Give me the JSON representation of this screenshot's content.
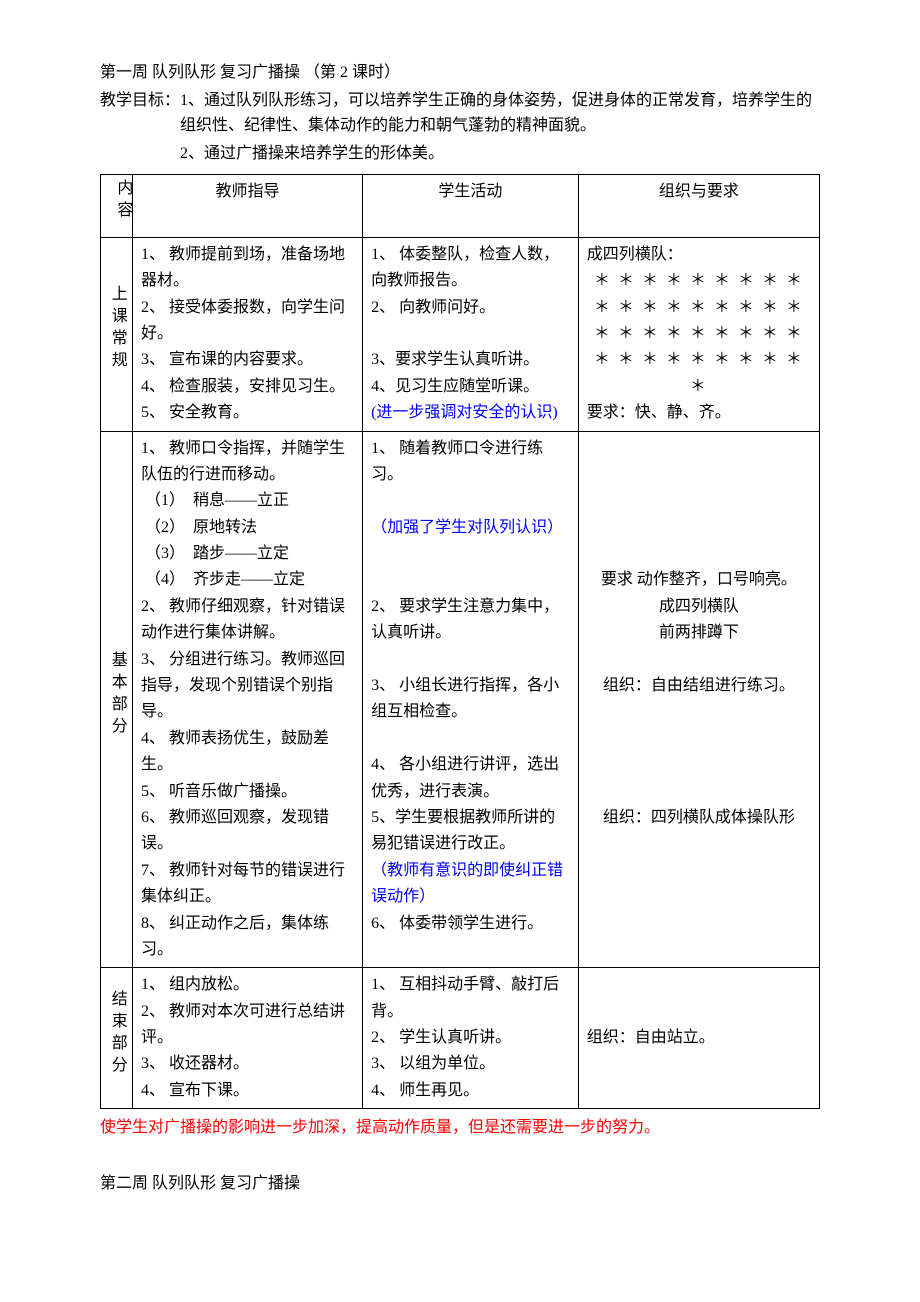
{
  "header": {
    "title_line": "第一周  队列队形    复习广播操    （第 2 课时）",
    "goal_label": "教学目标：",
    "goal1": "1、通过队列队形练习，可以培养学生正确的身体姿势，促进身体的正常发育，培养学生的组织性、纪律性、集体动作的能力和朝气蓬勃的精神面貌。",
    "goal2": "2、通过广播操来培养学生的形体美。"
  },
  "table": {
    "headers": {
      "section": "内容",
      "teacher": "教师指导",
      "student": "学生活动",
      "org": "组织与要求"
    },
    "rows": [
      {
        "section": "上课常规",
        "teacher": "1、 教师提前到场，准备场地器材。\n2、 接受体委报数，向学生问好。\n3、 宣布课的内容要求。\n4、 检查服装，安排见习生。\n5、 安全教育。",
        "student_main": "1、 体委整队，检查人数，向教师报告。\n2、 向教师问好。\n\n3、要求学生认真听讲。\n4、见习生应随堂听课。",
        "student_blue": "(进一步强调对安全的认识)",
        "org": "成四列横队：",
        "org_stars": "＊ ＊ ＊ ＊ ＊ ＊ ＊ ＊ ＊\n＊ ＊ ＊ ＊ ＊ ＊ ＊ ＊ ＊\n＊ ＊ ＊ ＊ ＊ ＊ ＊ ＊ ＊\n＊ ＊ ＊ ＊ ＊ ＊ ＊ ＊ ＊\n＊",
        "org_req": "要求：快、静、齐。"
      },
      {
        "section": "基本部分",
        "teacher": "1、 教师口令指挥，并随学生队伍的行进而移动。\n （1）  稍息——立正\n （2）  原地转法\n （3）  踏步——立定\n （4）  齐步走——立定\n2、 教师仔细观察，针对错误动作进行集体讲解。\n3、 分组进行练习。教师巡回指导，发现个别错误个别指导。\n4、 教师表扬优生，鼓励差生。\n5、 听音乐做广播操。\n6、 教师巡回观察，发现错误。\n7、 教师针对每节的错误进行集体纠正。\n8、 纠正动作之后，集体练习。",
        "student_p1": "1、 随着教师口令进行练习。\n\n",
        "student_blue1": "（加强了学生对队列认识）",
        "student_p2": "\n\n2、 要求学生注意力集中，认真听讲。\n\n3、 小组长进行指挥，各小组互相检查。\n\n4、 各小组进行讲评，选出优秀，进行表演。\n5、学生要根据教师所讲的易犯错误进行改正。\n",
        "student_blue2": "（教师有意识的即使纠正错误动作）",
        "student_p3": "6、 体委带领学生进行。",
        "org": "\n\n\n\n\n要求 动作整齐，口号响亮。\n成四列横队\n前两排蹲下\n\n组织：自由结组进行练习。\n\n\n\n\n组织：四列横队成体操队形"
      },
      {
        "section": "结束部分",
        "teacher": "1、 组内放松。\n2、 教师对本次可进行总结讲评。\n3、 收还器材。\n4、 宣布下课。",
        "student": "1、 互相抖动手臂、敲打后背。\n2、 学生认真听讲。\n3、 以组为单位。\n4、 师生再见。",
        "org": "\n\n组织：自由站立。"
      }
    ]
  },
  "footnote": "使学生对广播操的影响进一步加深，提高动作质量，但是还需要进一步的努力。",
  "next_week": "第二周  队列队形    复习广播操"
}
